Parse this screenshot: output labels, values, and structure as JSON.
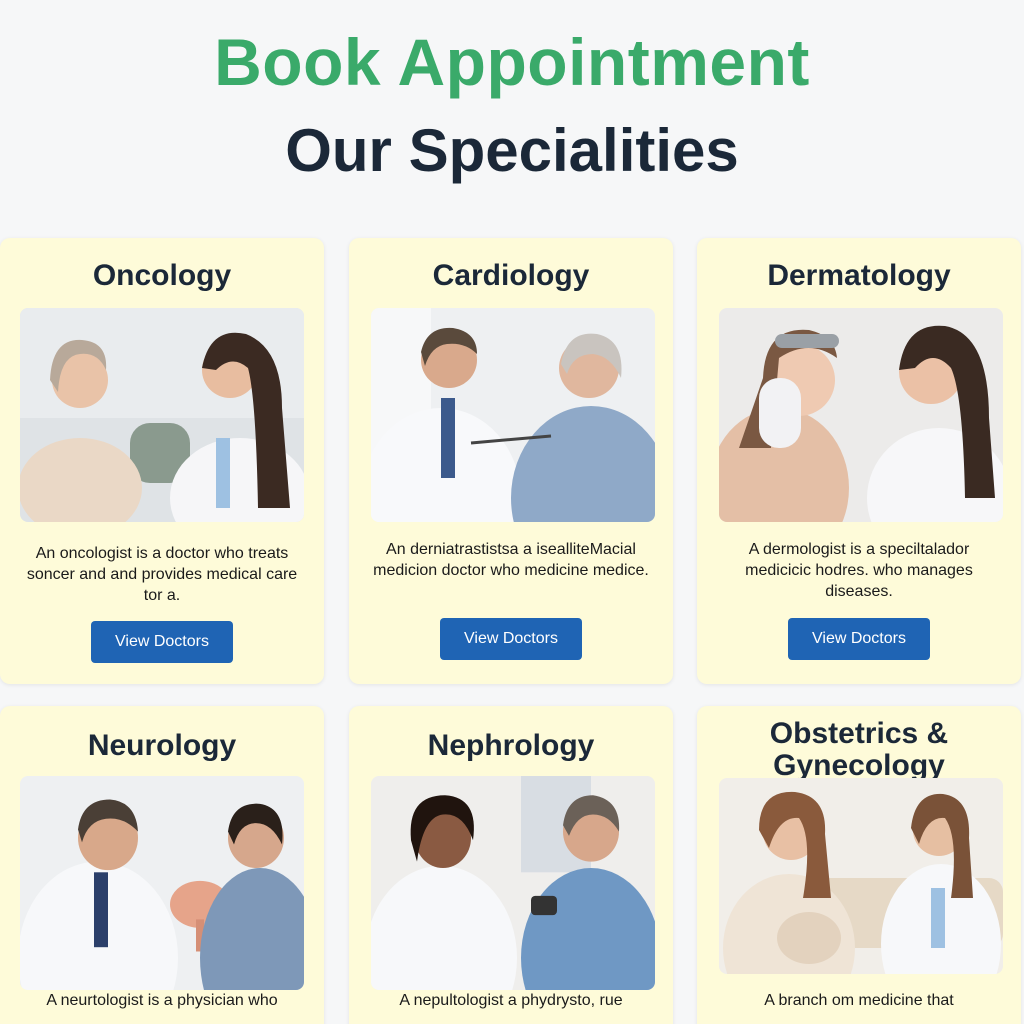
{
  "header": {
    "title": "Book Appointment",
    "subtitle": "Our Specialities"
  },
  "colors": {
    "title_green": "#3aaa6a",
    "heading_dark": "#1b2838",
    "card_bg": "#fefbd9",
    "button_blue": "#1f64b4"
  },
  "specialities": [
    {
      "name": "Oncology",
      "description": "An oncologist is a doctor who treats soncer and and provides medical care tor a.",
      "button_label": "View Doctors"
    },
    {
      "name": "Cardiology",
      "description": "An derniatrastistsa a isealliteMacial medicion doctor who medicine medice.",
      "button_label": "View Doctors"
    },
    {
      "name": "Dermatology",
      "description": "A dermologist is a speciltalador medicicic hodres. who manages diseases.",
      "button_label": "View Doctors"
    },
    {
      "name": "Neurology",
      "description": "A neurtologist is a physician who"
    },
    {
      "name": "Nephrology",
      "description": "A nepultologist a phydrysto, rue"
    },
    {
      "name": "Obstetrics & Gynecology",
      "description": "A branch om medicine that"
    }
  ]
}
